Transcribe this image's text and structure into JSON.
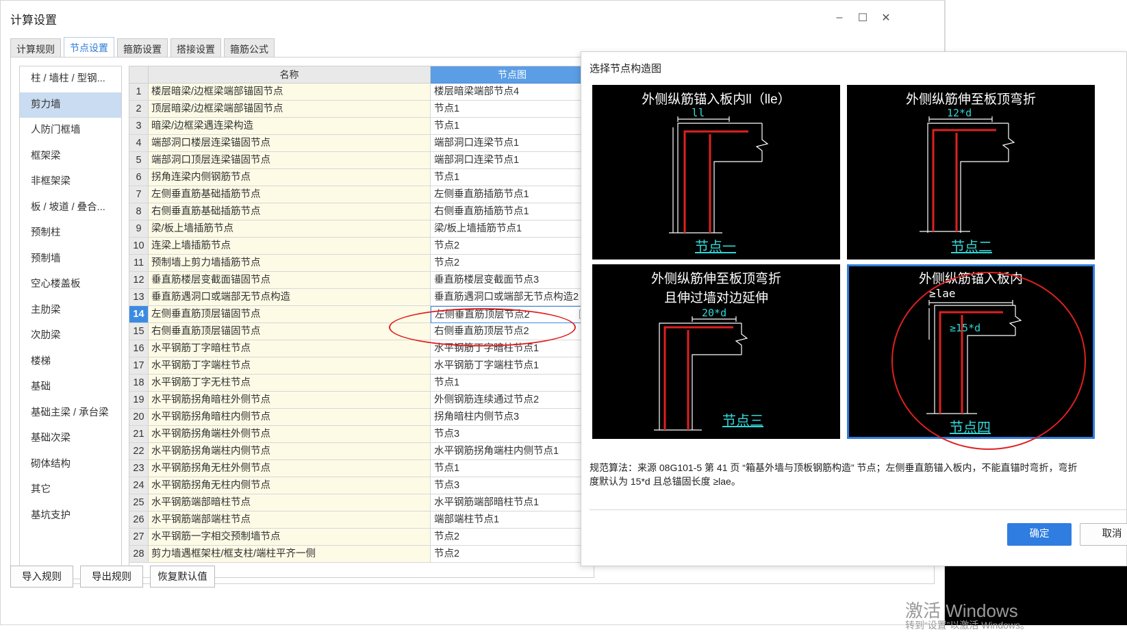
{
  "dialog": {
    "title": "计算设置"
  },
  "window_controls": {
    "minimize": "–",
    "maximize": "☐",
    "close": "✕"
  },
  "tabs": [
    {
      "label": "计算规则"
    },
    {
      "label": "节点设置",
      "active": true
    },
    {
      "label": "箍筋设置"
    },
    {
      "label": "搭接设置"
    },
    {
      "label": "箍筋公式"
    }
  ],
  "categories": [
    "柱 / 墙柱 / 型钢...",
    "剪力墙",
    "人防门框墙",
    "框架梁",
    "非框架梁",
    "板 / 坡道 / 叠合...",
    "预制柱",
    "预制墙",
    "空心楼盖板",
    "主肋梁",
    "次肋梁",
    "楼梯",
    "基础",
    "基础主梁 / 承台梁",
    "基础次梁",
    "砌体结构",
    "其它",
    "基坑支护"
  ],
  "selected_category": "剪力墙",
  "grid": {
    "headers": {
      "name": "名称",
      "node": "节点图"
    },
    "selected_row": "14",
    "rows": [
      {
        "num": "1",
        "name": "楼层暗梁/边框梁端部锚固节点",
        "node": "楼层暗梁端部节点4"
      },
      {
        "num": "2",
        "name": "顶层暗梁/边框梁端部锚固节点",
        "node": "节点1"
      },
      {
        "num": "3",
        "name": "暗梁/边框梁遇连梁构造",
        "node": "节点1"
      },
      {
        "num": "4",
        "name": "端部洞口楼层连梁锚固节点",
        "node": "端部洞口连梁节点1"
      },
      {
        "num": "5",
        "name": "端部洞口顶层连梁锚固节点",
        "node": "端部洞口连梁节点1"
      },
      {
        "num": "6",
        "name": "拐角连梁内侧钢筋节点",
        "node": "节点1"
      },
      {
        "num": "7",
        "name": "左侧垂直筋基础插筋节点",
        "node": "左侧垂直筋插筋节点1"
      },
      {
        "num": "8",
        "name": "右侧垂直筋基础插筋节点",
        "node": "右侧垂直筋插筋节点1"
      },
      {
        "num": "9",
        "name": "梁/板上墙插筋节点",
        "node": "梁/板上墙插筋节点1"
      },
      {
        "num": "10",
        "name": "连梁上墙插筋节点",
        "node": "节点2"
      },
      {
        "num": "11",
        "name": "预制墙上剪力墙插筋节点",
        "node": "节点2"
      },
      {
        "num": "12",
        "name": "垂直筋楼层变截面锚固节点",
        "node": "垂直筋楼层变截面节点3"
      },
      {
        "num": "13",
        "name": "垂直筋遇洞口或端部无节点构造",
        "node": "垂直筋遇洞口或端部无节点构造2"
      },
      {
        "num": "14",
        "name": "左侧垂直筋顶层锚固节点",
        "node": "左侧垂直筋顶层节点2"
      },
      {
        "num": "15",
        "name": "右侧垂直筋顶层锚固节点",
        "node": "右侧垂直筋顶层节点2"
      },
      {
        "num": "16",
        "name": "水平钢筋丁字暗柱节点",
        "node": "水平钢筋丁字暗柱节点1"
      },
      {
        "num": "17",
        "name": "水平钢筋丁字端柱节点",
        "node": "水平钢筋丁字端柱节点1"
      },
      {
        "num": "18",
        "name": "水平钢筋丁字无柱节点",
        "node": "节点1"
      },
      {
        "num": "19",
        "name": "水平钢筋拐角暗柱外侧节点",
        "node": "外侧钢筋连续通过节点2"
      },
      {
        "num": "20",
        "name": "水平钢筋拐角暗柱内侧节点",
        "node": "拐角暗柱内侧节点3"
      },
      {
        "num": "21",
        "name": "水平钢筋拐角端柱外侧节点",
        "node": "节点3"
      },
      {
        "num": "22",
        "name": "水平钢筋拐角端柱内侧节点",
        "node": "水平钢筋拐角端柱内侧节点1"
      },
      {
        "num": "23",
        "name": "水平钢筋拐角无柱外侧节点",
        "node": "节点1"
      },
      {
        "num": "24",
        "name": "水平钢筋拐角无柱内侧节点",
        "node": "节点3"
      },
      {
        "num": "25",
        "name": "水平钢筋端部暗柱节点",
        "node": "水平钢筋端部暗柱节点1"
      },
      {
        "num": "26",
        "name": "水平钢筋端部端柱节点",
        "node": "端部端柱节点1"
      },
      {
        "num": "27",
        "name": "水平钢筋一字相交预制墙节点",
        "node": "节点2"
      },
      {
        "num": "28",
        "name": "剪力墙遇框架柱/框支柱/端柱平齐一侧",
        "node": "节点2"
      }
    ]
  },
  "bottom_buttons": {
    "import": "导入规则",
    "export": "导出规则",
    "restore": "恢复默认值"
  },
  "node_panel": {
    "title": "选择节点构造图",
    "tiles": [
      {
        "heading": "外侧纵筋锚入板内ll（lle）",
        "dim": "ll",
        "footer": "节点一"
      },
      {
        "heading": "外侧纵筋伸至板顶弯折",
        "dim": "12*d",
        "footer": "节点二"
      },
      {
        "heading": "外侧纵筋伸至板顶弯折\n且伸过墙对边延伸",
        "dim": "20*d",
        "footer": "节点三"
      },
      {
        "heading": "外侧纵筋锚入板内",
        "dim_top": "≥lae",
        "dim": "≥15*d",
        "footer": "节点四",
        "selected": true
      }
    ],
    "description": "规范算法：来源 08G101-5 第 41 页 “箱基外墙与顶板钢筋构造” 节点；左侧垂直筋锚入板内，不能直锚时弯折，弯折\n度默认为 15*d 且总锚固长度 ≥lae。",
    "ok_label": "确定",
    "cancel_label": "取消"
  },
  "watermark": {
    "line1": "激活 Windows",
    "line2": "转到“设置”以激活 Windows。"
  },
  "colors": {
    "accent": "#2f7de0",
    "rebar": "#e02020",
    "dim": "#33d6d6",
    "highlight_ellipse": "#e02020"
  }
}
